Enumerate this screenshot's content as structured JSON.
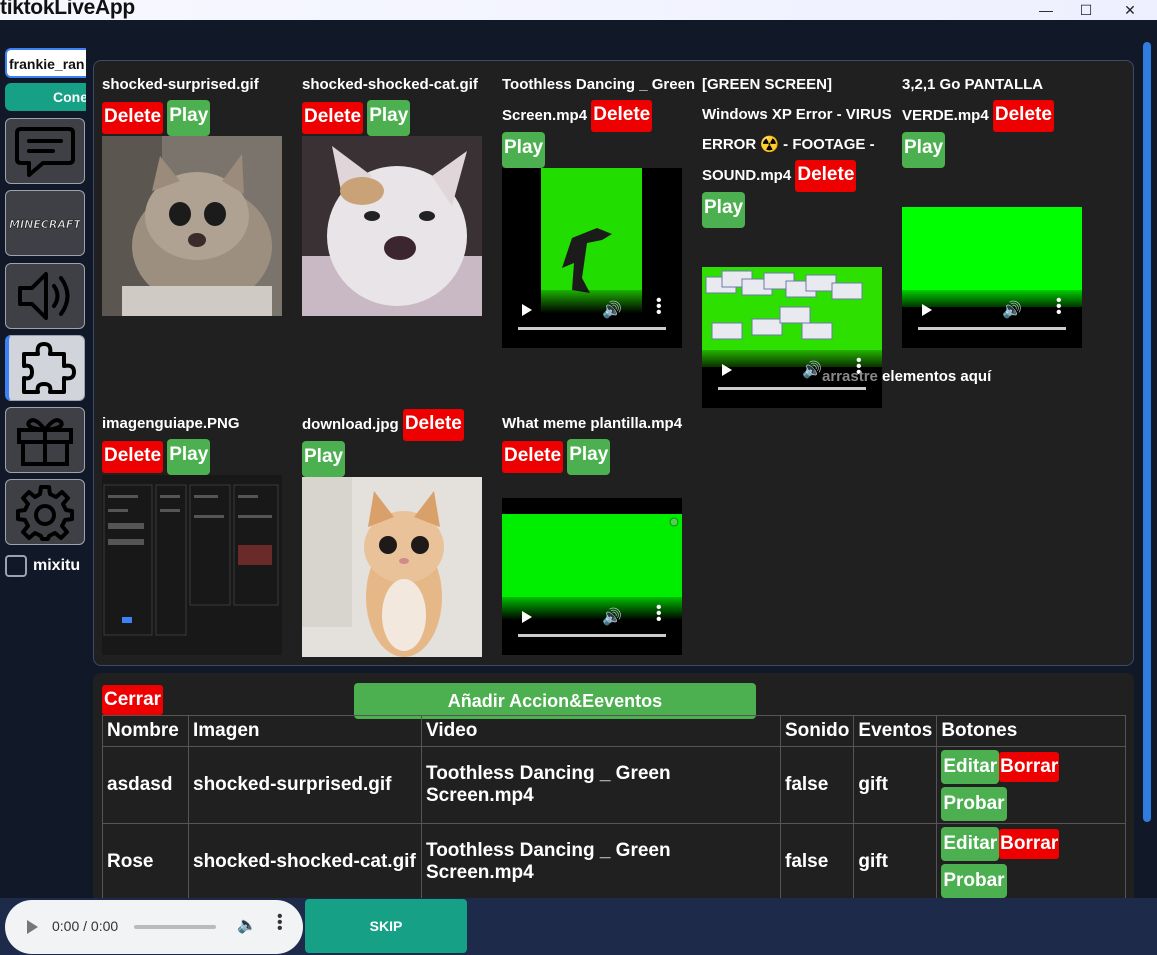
{
  "window": {
    "title": "tiktokLiveApp",
    "min_label": "—",
    "max_label": "☐",
    "close_label": "✕"
  },
  "sidebar": {
    "username_value": "frankie_ran",
    "connect_label": "Conectar",
    "items": [
      {
        "name": "chat",
        "icon": "chat-icon"
      },
      {
        "name": "minecraft",
        "icon": "minecraft-logo",
        "label": "MINECRAFT"
      },
      {
        "name": "sound",
        "icon": "speaker-icon"
      },
      {
        "name": "overlays",
        "icon": "puzzle-icon"
      },
      {
        "name": "gifts",
        "icon": "gift-icon"
      },
      {
        "name": "settings",
        "icon": "gear-icon"
      }
    ],
    "mixitu_label": "mixitu"
  },
  "media": {
    "delete_label": "Delete",
    "play_label": "Play",
    "files": [
      {
        "name": "shocked-surprised.gif",
        "type": "image"
      },
      {
        "name": "shocked-shocked-cat.gif",
        "type": "image"
      },
      {
        "name_line1": "Toothless Dancing _ Green",
        "name_line2": "Screen.mp4",
        "type": "video"
      },
      {
        "name_line1": "[GREEN SCREEN]",
        "name_line2": "Windows XP Error - VIRUS",
        "name_line3": "ERROR ☢️ - FOOTAGE -",
        "name_line4": "SOUND.mp4",
        "type": "video"
      },
      {
        "name_line1": "3,2,1 Go PANTALLA",
        "name_line2": "VERDE.mp4",
        "type": "video"
      },
      {
        "name": "imagenguiape.PNG",
        "type": "image"
      },
      {
        "name": "download.jpg",
        "type": "image"
      },
      {
        "name": "What meme plantilla.mp4",
        "type": "video"
      }
    ],
    "drop_hint_faint": "arrastre",
    "drop_hint": " elementos aquí"
  },
  "events": {
    "close_label": "Cerrar",
    "add_label": "Añadir Accion&Eeventos",
    "headers": [
      "Nombre",
      "Imagen",
      "Video",
      "Sonido",
      "Eventos",
      "Botones"
    ],
    "rows": [
      {
        "nombre": "asdasd",
        "imagen": "shocked-surprised.gif",
        "video": "Toothless Dancing _ Green Screen.mp4",
        "sonido": "false",
        "eventos": "gift"
      },
      {
        "nombre": "Rose",
        "imagen": "shocked-shocked-cat.gif",
        "video": "Toothless Dancing _ Green Screen.mp4",
        "sonido": "false",
        "eventos": "gift"
      }
    ],
    "edit_label": "Editar",
    "delete_label": "Borrar",
    "test_label": "Probar"
  },
  "player": {
    "time": "0:00 / 0:00",
    "skip_label": "SKIP"
  }
}
